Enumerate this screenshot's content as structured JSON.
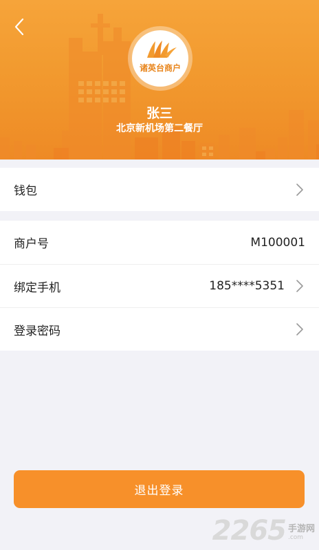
{
  "colors": {
    "header_gradient_top": "#f6a43a",
    "header_gradient_bottom": "#ee8a25",
    "accent": "#f7902a",
    "page_background": "#f2f2f7"
  },
  "header": {
    "back_icon": "chevron-left-icon",
    "logo_text": "诸英台商户",
    "user_name": "张三",
    "store_name": "北京新机场第二餐厅"
  },
  "wallet": {
    "label": "钱包",
    "icon": "chevron-right-icon"
  },
  "account": {
    "merchant_id_label": "商户号",
    "merchant_id_value": "M100001",
    "phone_label": "绑定手机",
    "phone_value": "185****5351",
    "password_label": "登录密码"
  },
  "logout_label": "退出登录",
  "watermark": {
    "number": "2265",
    "cn": "手游网",
    "domain": ".com"
  }
}
